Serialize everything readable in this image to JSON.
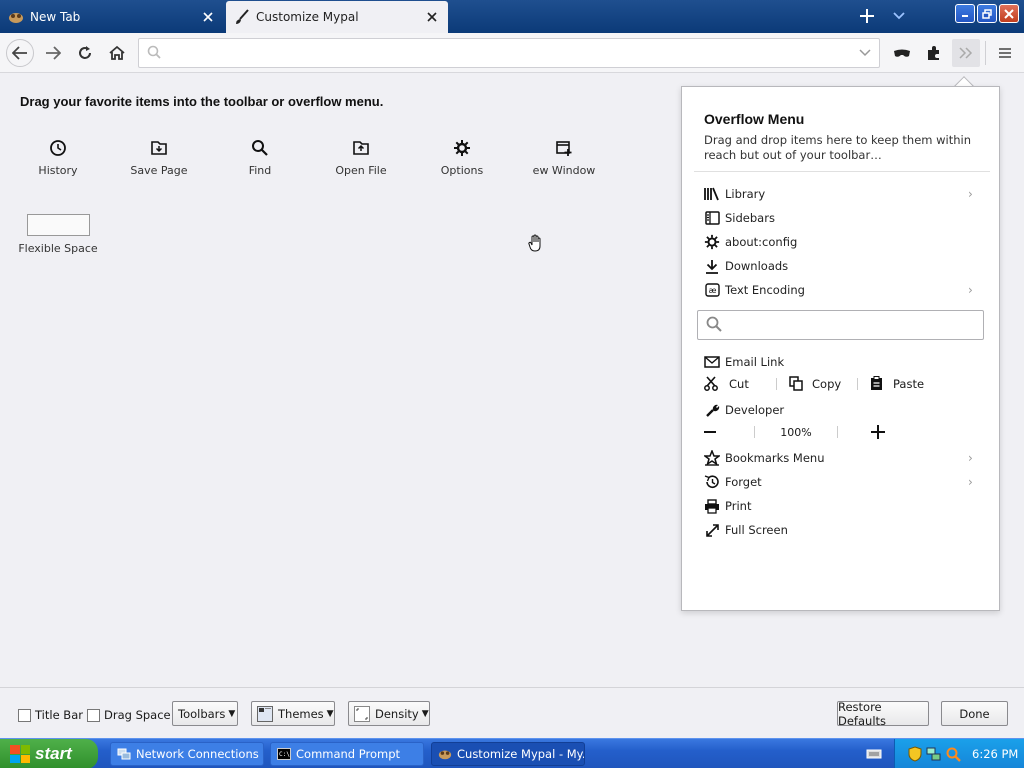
{
  "browser": {
    "tabs": [
      {
        "label": "New Tab",
        "icon": "app-icon",
        "active": false
      },
      {
        "label": "Customize Mypal",
        "icon": "paintbrush-icon",
        "active": true
      }
    ],
    "window_controls": [
      "minimize",
      "restore",
      "close"
    ],
    "url": {
      "value": "",
      "placeholder": ""
    },
    "toolbar_icons": [
      "back-icon",
      "forward-icon",
      "reload-icon",
      "home-icon",
      "private-mask-icon",
      "addons-icon",
      "overflow-chevrons-icon",
      "menu-icon"
    ]
  },
  "customize": {
    "heading": "Drag your favorite items into the toolbar or overflow menu.",
    "palette": [
      {
        "label": "History",
        "icon": "clock-icon"
      },
      {
        "label": "Save Page",
        "icon": "save-page-icon"
      },
      {
        "label": "Find",
        "icon": "magnifier-icon"
      },
      {
        "label": "Open File",
        "icon": "open-file-icon"
      },
      {
        "label": "Options",
        "icon": "gear-icon"
      },
      {
        "label": "ew Window",
        "icon": "new-window-icon"
      }
    ],
    "flexible_space": "Flexible Space"
  },
  "overflow": {
    "title": "Overflow Menu",
    "description": "Drag and drop items here to keep them within reach but out of your toolbar…",
    "items_top": [
      {
        "label": "Library",
        "icon": "library-icon",
        "submenu": true
      },
      {
        "label": "Sidebars",
        "icon": "sidebar-icon",
        "submenu": false
      },
      {
        "label": "about:config",
        "icon": "gear-icon",
        "submenu": false
      },
      {
        "label": "Downloads",
        "icon": "download-icon",
        "submenu": false
      },
      {
        "label": "Text Encoding",
        "icon": "text-encoding-icon",
        "submenu": true
      }
    ],
    "search_placeholder": "",
    "email_link": "Email Link",
    "edit": {
      "cut": "Cut",
      "copy": "Copy",
      "paste": "Paste"
    },
    "developer": "Developer",
    "zoom": {
      "minus": "−",
      "level": "100%",
      "plus": "+"
    },
    "items_bottom": [
      {
        "label": "Bookmarks Menu",
        "icon": "bookmarks-star-icon",
        "submenu": true
      },
      {
        "label": "Forget",
        "icon": "forget-icon",
        "submenu": true
      },
      {
        "label": "Print",
        "icon": "print-icon",
        "submenu": false
      },
      {
        "label": "Full Screen",
        "icon": "fullscreen-icon",
        "submenu": false
      }
    ]
  },
  "footer": {
    "title_bar": "Title Bar",
    "drag_space": "Drag Space",
    "toolbars": "Toolbars",
    "themes": "Themes",
    "density": "Density",
    "restore_defaults": "Restore Defaults",
    "done": "Done"
  },
  "taskbar": {
    "start": "start",
    "tasks": [
      {
        "label": "Network Connections",
        "icon": "network-icon",
        "active": false
      },
      {
        "label": "Command Prompt",
        "icon": "cmd-icon",
        "active": false
      },
      {
        "label": "Customize Mypal - My...",
        "icon": "app-icon",
        "active": true
      }
    ],
    "clock": "6:26 PM"
  },
  "colors": {
    "taskbar": "#245fcb",
    "start": "#2f8f2c",
    "tabstrip": "#0b3a78",
    "tray": "#1585d8"
  }
}
